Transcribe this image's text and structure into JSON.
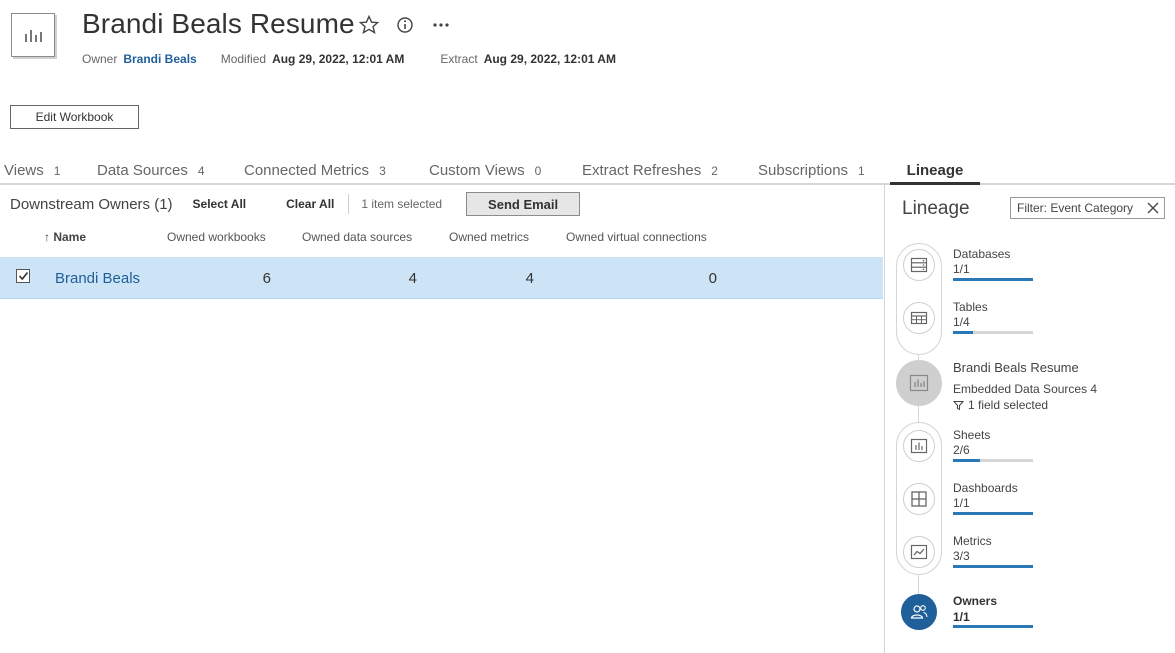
{
  "header": {
    "title": "Brandi Beals Resume",
    "owner_label": "Owner",
    "owner_name": "Brandi Beals",
    "modified_label": "Modified",
    "modified_value": "Aug 29, 2022, 12:01 AM",
    "extract_label": "Extract",
    "extract_value": "Aug 29, 2022, 12:01 AM",
    "icons": [
      "workbook-icon",
      "star-icon",
      "info-icon",
      "more-icon"
    ]
  },
  "edit_button": "Edit Workbook",
  "tabs": [
    {
      "label": "Views",
      "count": "1"
    },
    {
      "label": "Data Sources",
      "count": "4"
    },
    {
      "label": "Connected Metrics",
      "count": "3"
    },
    {
      "label": "Custom Views",
      "count": "0"
    },
    {
      "label": "Extract Refreshes",
      "count": "2"
    },
    {
      "label": "Subscriptions",
      "count": "1"
    },
    {
      "label": "Lineage",
      "count": ""
    }
  ],
  "toolbar": {
    "title": "Downstream Owners (1)",
    "select_all": "Select All",
    "clear_all": "Clear All",
    "status": "1 item selected",
    "send_email": "Send Email"
  },
  "table": {
    "columns": [
      "↑ Name",
      "Owned workbooks",
      "Owned data sources",
      "Owned metrics",
      "Owned virtual connections"
    ],
    "rows": [
      {
        "name": "Brandi Beals",
        "workbooks": "6",
        "data_sources": "4",
        "metrics": "4",
        "virtual_connections": "0",
        "checked": true
      }
    ]
  },
  "lineage": {
    "title": "Lineage",
    "filter": "Filter: Event Category",
    "items": [
      {
        "label": "Databases",
        "count": "1/1",
        "fill": 1.0,
        "icon": "database-icon"
      },
      {
        "label": "Tables",
        "count": "1/4",
        "fill": 0.25,
        "icon": "table-icon"
      },
      {
        "label": "Sheets",
        "count": "2/6",
        "fill": 0.333,
        "icon": "sheet-icon"
      },
      {
        "label": "Dashboards",
        "count": "1/1",
        "fill": 1.0,
        "icon": "dashboard-icon"
      },
      {
        "label": "Metrics",
        "count": "3/3",
        "fill": 1.0,
        "icon": "metric-icon"
      },
      {
        "label": "Owners",
        "count": "1/1",
        "fill": 1.0,
        "icon": "owners-icon"
      }
    ],
    "workbook": {
      "name": "Brandi Beals Resume",
      "embedded": "Embedded Data Sources 4",
      "field": "1 field selected"
    }
  },
  "colors": {
    "accent": "#1f5f9a",
    "row_selected": "#cde4f6",
    "progress": "#2b78b6"
  }
}
